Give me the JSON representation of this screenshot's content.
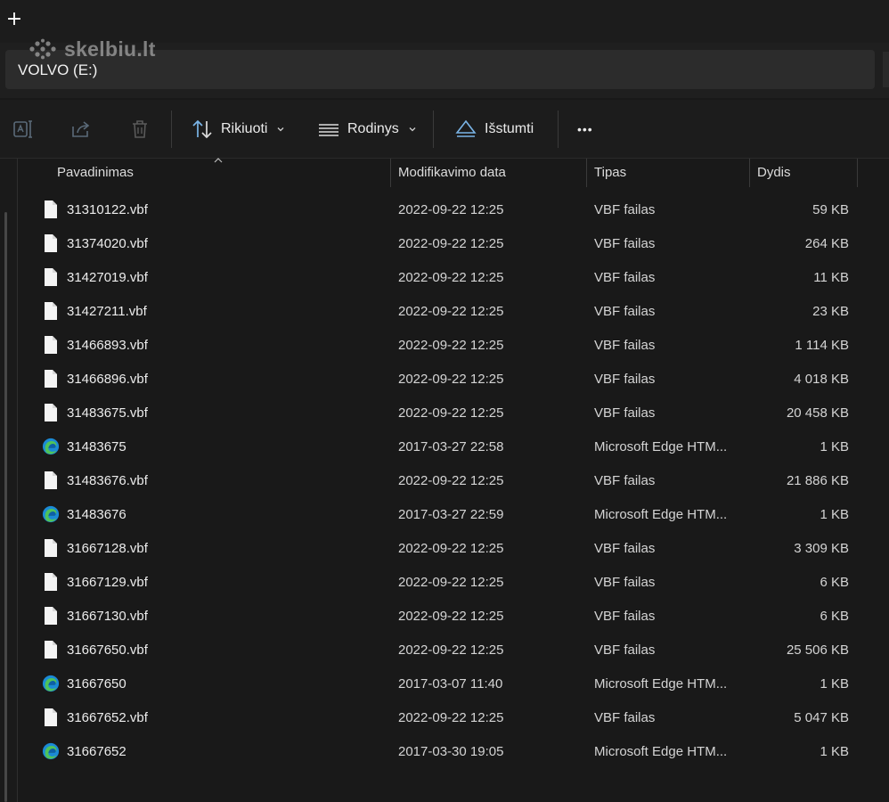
{
  "titlebar": {
    "new_tab": "+"
  },
  "watermark": {
    "text": "skelbiu.lt"
  },
  "address": {
    "path": "VOLVO (E:)"
  },
  "toolbar": {
    "sort_label": "Rikiuoti",
    "view_label": "Rodinys",
    "eject_label": "Išstumti",
    "more_label": "•••"
  },
  "columns": {
    "name": "Pavadinimas",
    "modified": "Modifikavimo data",
    "type": "Tipas",
    "size": "Dydis"
  },
  "files": [
    {
      "name": "31310122.vbf",
      "date": "2022-09-22 12:25",
      "type": "VBF failas",
      "size": "59 KB",
      "icon": "file-icon"
    },
    {
      "name": "31374020.vbf",
      "date": "2022-09-22 12:25",
      "type": "VBF failas",
      "size": "264 KB",
      "icon": "file-icon"
    },
    {
      "name": "31427019.vbf",
      "date": "2022-09-22 12:25",
      "type": "VBF failas",
      "size": "11 KB",
      "icon": "file-icon"
    },
    {
      "name": "31427211.vbf",
      "date": "2022-09-22 12:25",
      "type": "VBF failas",
      "size": "23 KB",
      "icon": "file-icon"
    },
    {
      "name": "31466893.vbf",
      "date": "2022-09-22 12:25",
      "type": "VBF failas",
      "size": "1 114 KB",
      "icon": "file-icon"
    },
    {
      "name": "31466896.vbf",
      "date": "2022-09-22 12:25",
      "type": "VBF failas",
      "size": "4 018 KB",
      "icon": "file-icon"
    },
    {
      "name": "31483675.vbf",
      "date": "2022-09-22 12:25",
      "type": "VBF failas",
      "size": "20 458 KB",
      "icon": "file-icon"
    },
    {
      "name": "31483675",
      "date": "2017-03-27 22:58",
      "type": "Microsoft Edge HTM...",
      "size": "1 KB",
      "icon": "edge-icon"
    },
    {
      "name": "31483676.vbf",
      "date": "2022-09-22 12:25",
      "type": "VBF failas",
      "size": "21 886 KB",
      "icon": "file-icon"
    },
    {
      "name": "31483676",
      "date": "2017-03-27 22:59",
      "type": "Microsoft Edge HTM...",
      "size": "1 KB",
      "icon": "edge-icon"
    },
    {
      "name": "31667128.vbf",
      "date": "2022-09-22 12:25",
      "type": "VBF failas",
      "size": "3 309 KB",
      "icon": "file-icon"
    },
    {
      "name": "31667129.vbf",
      "date": "2022-09-22 12:25",
      "type": "VBF failas",
      "size": "6 KB",
      "icon": "file-icon"
    },
    {
      "name": "31667130.vbf",
      "date": "2022-09-22 12:25",
      "type": "VBF failas",
      "size": "6 KB",
      "icon": "file-icon"
    },
    {
      "name": "31667650.vbf",
      "date": "2022-09-22 12:25",
      "type": "VBF failas",
      "size": "25 506 KB",
      "icon": "file-icon"
    },
    {
      "name": "31667650",
      "date": "2017-03-07 11:40",
      "type": "Microsoft Edge HTM...",
      "size": "1 KB",
      "icon": "edge-icon"
    },
    {
      "name": "31667652.vbf",
      "date": "2022-09-22 12:25",
      "type": "VBF failas",
      "size": "5 047 KB",
      "icon": "file-icon"
    },
    {
      "name": "31667652",
      "date": "2017-03-30 19:05",
      "type": "Microsoft Edge HTM...",
      "size": "1 KB",
      "icon": "edge-icon"
    }
  ],
  "colors": {
    "background": "#191919",
    "toolbar": "#1c1c1c",
    "address_bar": "#2c2c2c",
    "edge_blue": "#1b8ad6",
    "edge_green": "#4fc35a"
  }
}
